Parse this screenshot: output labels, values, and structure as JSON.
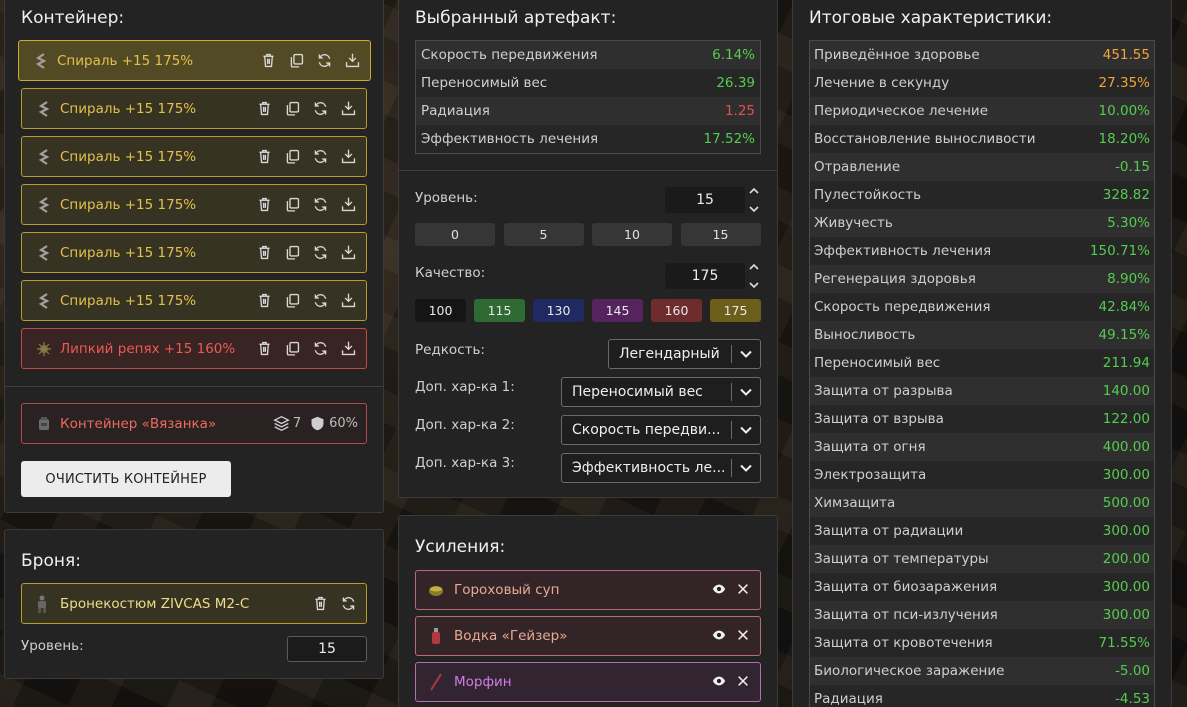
{
  "container": {
    "title": "Контейнер:",
    "artifacts": [
      {
        "name": "Спираль +15 175%",
        "tone": "gold",
        "selected": true
      },
      {
        "name": "Спираль +15 175%",
        "tone": "gold"
      },
      {
        "name": "Спираль +15 175%",
        "tone": "gold"
      },
      {
        "name": "Спираль +15 175%",
        "tone": "gold"
      },
      {
        "name": "Спираль +15 175%",
        "tone": "gold"
      },
      {
        "name": "Спираль +15 175%",
        "tone": "gold"
      },
      {
        "name": "Липкий репях +15 160%",
        "tone": "red"
      }
    ],
    "item": {
      "name": "Контейнер «Вязанка»",
      "slots": "7",
      "protection": "60%"
    },
    "clear_button": "ОЧИСТИТЬ КОНТЕЙНЕР"
  },
  "armor": {
    "title": "Броня:",
    "item_name": "Бронекостюм ZIVCAS M2-C",
    "level_label": "Уровень:",
    "level_value": "15"
  },
  "selected_artifact": {
    "title": "Выбранный артефакт:",
    "stats": [
      {
        "label": "Скорость передвижения",
        "value": "6.14%",
        "color": "green"
      },
      {
        "label": "Переносимый вес",
        "value": "26.39",
        "color": "green"
      },
      {
        "label": "Радиация",
        "value": "1.25",
        "color": "red"
      },
      {
        "label": "Эффективность лечения",
        "value": "17.52%",
        "color": "green"
      }
    ],
    "level_label": "Уровень:",
    "level_value": "15",
    "level_presets": [
      "0",
      "5",
      "10",
      "15"
    ],
    "quality_label": "Качество:",
    "quality_value": "175",
    "quality_presets": [
      {
        "label": "100",
        "color": "#151515"
      },
      {
        "label": "115",
        "color": "#2f6a35"
      },
      {
        "label": "130",
        "color": "#1f2a62"
      },
      {
        "label": "145",
        "color": "#55245e"
      },
      {
        "label": "160",
        "color": "#6e2c2c"
      },
      {
        "label": "175",
        "color": "#6e5e1c"
      }
    ],
    "rarity_label": "Редкость:",
    "rarity_value": "Легендарный",
    "extra1_label": "Доп. хар-ка 1:",
    "extra1_value": "Переносимый вес",
    "extra2_label": "Доп. хар-ка 2:",
    "extra2_value": "Скорость передви...",
    "extra3_label": "Доп. хар-ка 3:",
    "extra3_value": "Эффективность ле..."
  },
  "boosts": {
    "title": "Усиления:",
    "items": [
      {
        "name": "Гороховый суп",
        "tone": "pink",
        "icon": "soup-icon"
      },
      {
        "name": "Водка «Гейзер»",
        "tone": "pink",
        "icon": "bottle-icon"
      },
      {
        "name": "Морфин",
        "tone": "purple",
        "icon": "syringe-icon"
      }
    ]
  },
  "totals": {
    "title": "Итоговые характеристики:",
    "stats": [
      {
        "label": "Приведённое здоровье",
        "value": "451.55",
        "color": "orange"
      },
      {
        "label": "Лечение в секунду",
        "value": "27.35%",
        "color": "orange"
      },
      {
        "label": "Периодическое лечение",
        "value": "10.00%",
        "color": "green"
      },
      {
        "label": "Восстановление выносливости",
        "value": "18.20%",
        "color": "green"
      },
      {
        "label": "Отравление",
        "value": "-0.15",
        "color": "green"
      },
      {
        "label": "Пулестойкость",
        "value": "328.82",
        "color": "green"
      },
      {
        "label": "Живучесть",
        "value": "5.30%",
        "color": "green"
      },
      {
        "label": "Эффективность лечения",
        "value": "150.71%",
        "color": "green"
      },
      {
        "label": "Регенерация здоровья",
        "value": "8.90%",
        "color": "green"
      },
      {
        "label": "Скорость передвижения",
        "value": "42.84%",
        "color": "green"
      },
      {
        "label": "Выносливость",
        "value": "49.15%",
        "color": "green"
      },
      {
        "label": "Переносимый вес",
        "value": "211.94",
        "color": "green"
      },
      {
        "label": "Защита от разрыва",
        "value": "140.00",
        "color": "green"
      },
      {
        "label": "Защита от взрыва",
        "value": "122.00",
        "color": "green"
      },
      {
        "label": "Защита от огня",
        "value": "400.00",
        "color": "green"
      },
      {
        "label": "Электрозащита",
        "value": "300.00",
        "color": "green"
      },
      {
        "label": "Химзащита",
        "value": "500.00",
        "color": "green"
      },
      {
        "label": "Защита от радиации",
        "value": "300.00",
        "color": "green"
      },
      {
        "label": "Защита от температуры",
        "value": "200.00",
        "color": "green"
      },
      {
        "label": "Защита от биозаражения",
        "value": "300.00",
        "color": "green"
      },
      {
        "label": "Защита от пси-излучения",
        "value": "300.00",
        "color": "green"
      },
      {
        "label": "Защита от кровотечения",
        "value": "71.55%",
        "color": "green"
      },
      {
        "label": "Биологическое заражение",
        "value": "-5.00",
        "color": "green"
      },
      {
        "label": "Радиация",
        "value": "-4.53",
        "color": "green"
      }
    ]
  }
}
